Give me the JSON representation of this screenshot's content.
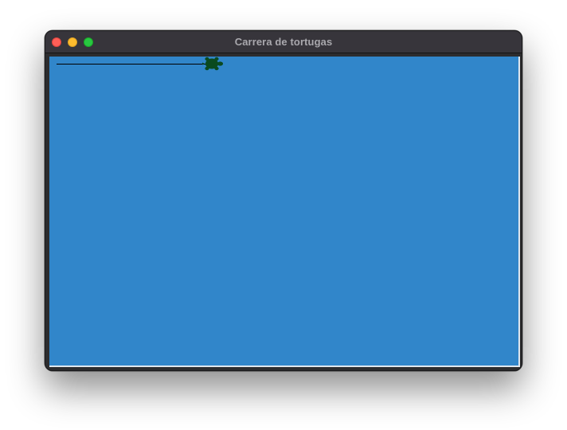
{
  "window": {
    "title": "Carrera de tortugas"
  },
  "controls": {
    "close": "close-button",
    "minimize": "minimize-button",
    "zoom": "zoom-button"
  },
  "canvas": {
    "background": "#3186ca",
    "turtle": {
      "color": "#0a4a1f",
      "shape": "turtle",
      "heading": "east",
      "pen": "down",
      "pen_color": "#000000"
    }
  }
}
